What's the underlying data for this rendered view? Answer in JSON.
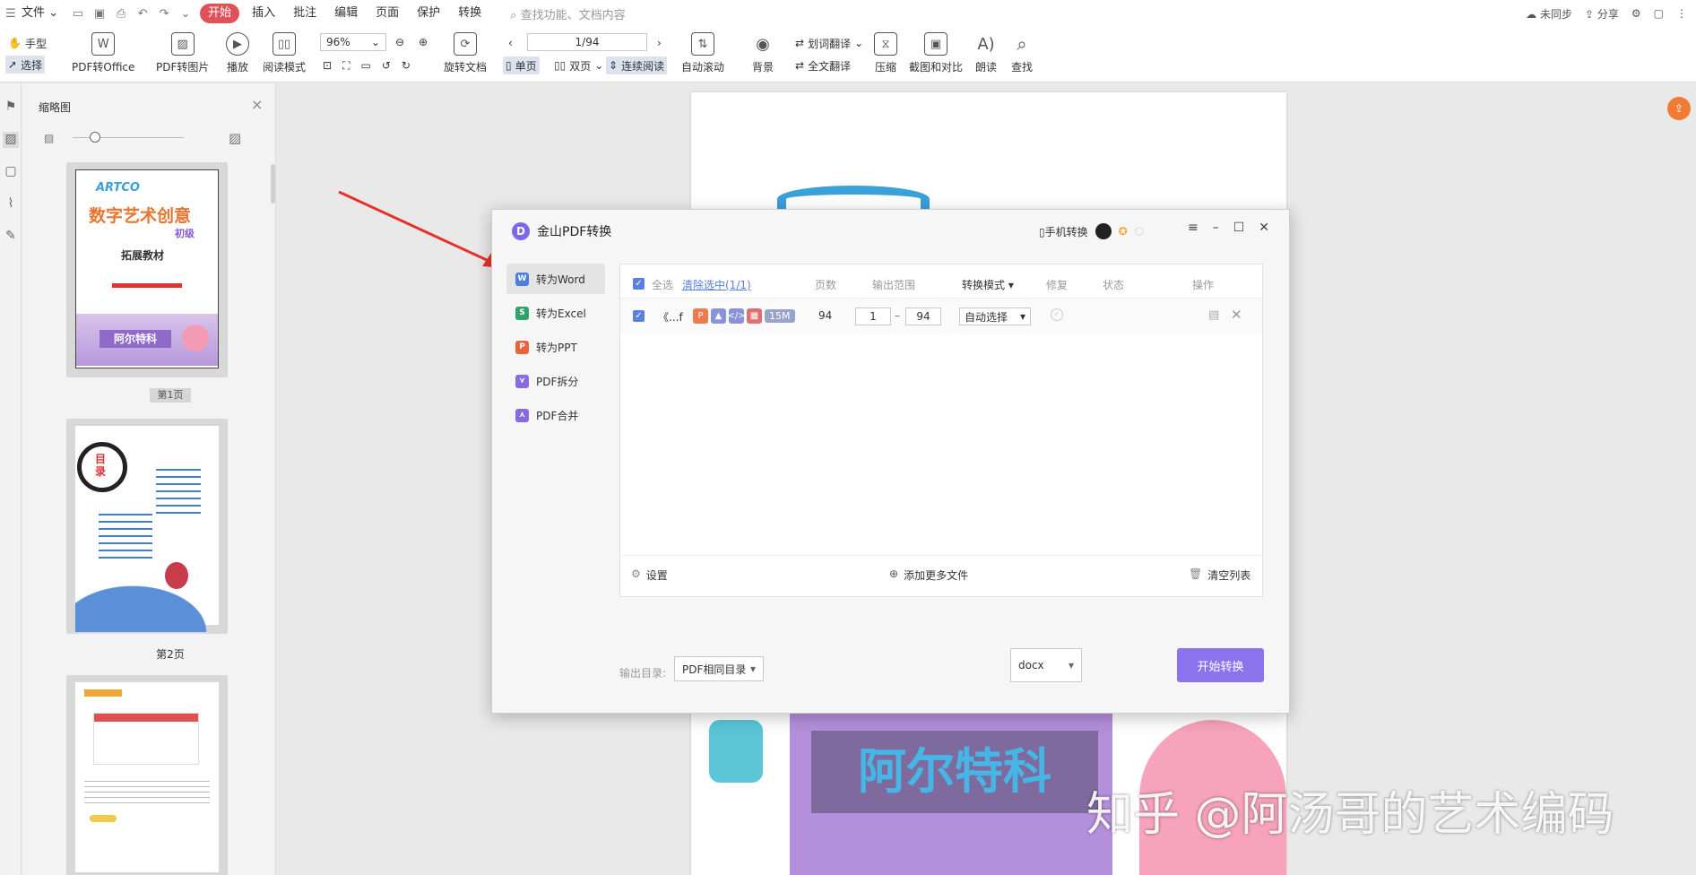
{
  "menubar": {
    "file": "文件",
    "items": [
      "开始",
      "插入",
      "批注",
      "编辑",
      "页面",
      "保护",
      "转换"
    ],
    "search_placeholder": "查找功能、文档内容",
    "sync": "未同步",
    "share": "分享"
  },
  "ribbon": {
    "hand": "手型",
    "select": "选择",
    "pdf_to_office": "PDF转Office",
    "pdf_to_image": "PDF转图片",
    "play": "播放",
    "read_mode": "阅读模式",
    "zoom": "96%",
    "rotate": "旋转文档",
    "page_indicator": "1/94",
    "single": "单页",
    "double": "双页",
    "continuous": "连续阅读",
    "auto_scroll": "自动滚动",
    "background": "背景",
    "word_translate": "划词翻译",
    "full_translate": "全文翻译",
    "compress": "压缩",
    "screenshot_compare": "截图和对比",
    "read_aloud": "朗读",
    "find": "查找"
  },
  "thumbpane": {
    "title": "缩略图",
    "page_labels": [
      "第1页",
      "第2页"
    ]
  },
  "thumbnail_text": {
    "cover_brand": "ARTCO",
    "cover_title": "数字艺术创意",
    "cover_level": "初级",
    "cover_subtitle": "拓展教材",
    "cover_sign": "阿尔特科",
    "toc_title": "目录"
  },
  "document": {
    "sign_text": "阿尔特科"
  },
  "dialog": {
    "title": "金山PDF转换",
    "phone_convert": "手机转换",
    "nav": [
      "转为Word",
      "转为Excel",
      "转为PPT",
      "PDF拆分",
      "PDF合并"
    ],
    "headers": {
      "select_all": "全选",
      "clear_selection": "清除选中(1/1)",
      "pages": "页数",
      "range": "输出范围",
      "mode": "转换模式",
      "repair": "修复",
      "status": "状态",
      "action": "操作"
    },
    "file_row": {
      "name": "《...f",
      "size": "15M",
      "pages": "94",
      "range_from": "1",
      "range_to": "94",
      "mode": "自动选择"
    },
    "footer": {
      "settings": "设置",
      "add_files": "添加更多文件",
      "clear_list": "清空列表"
    },
    "output_label": "输出目录:",
    "output_dir": "PDF相同目录",
    "format": "docx",
    "start": "开始转换"
  },
  "watermark": "知乎 @阿汤哥的艺术编码",
  "colors": {
    "accent": "#8c73ee",
    "active_tab": "#e0525a",
    "arrow": "#e8302a"
  }
}
